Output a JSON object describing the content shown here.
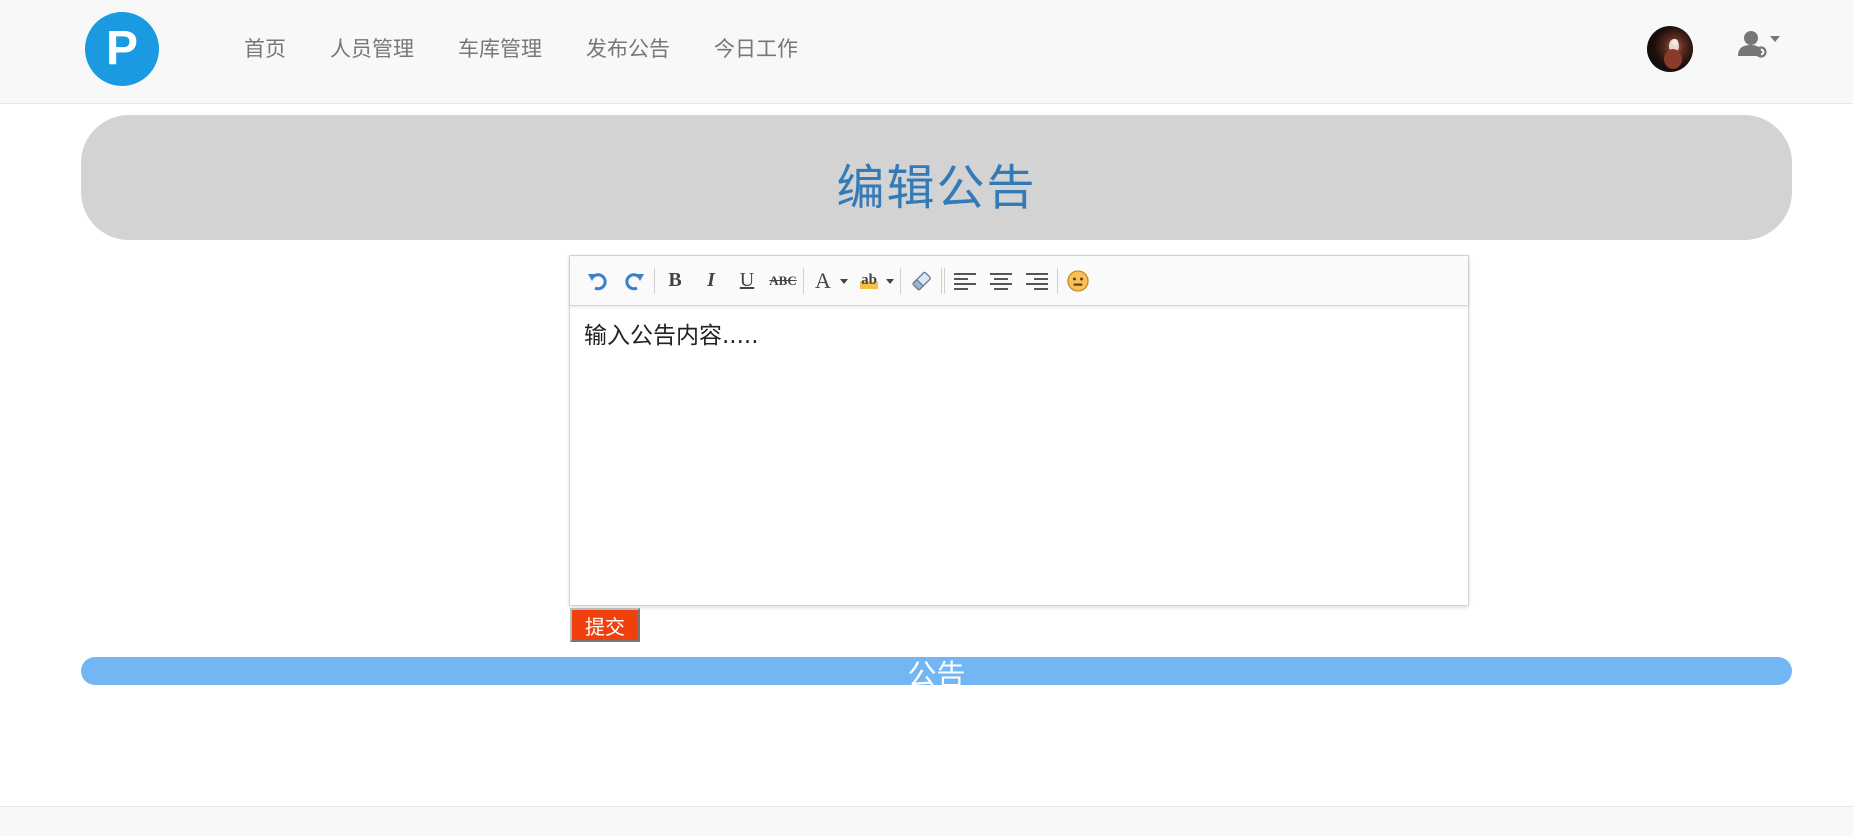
{
  "nav": {
    "logo_letter": "P",
    "links": [
      "首页",
      "人员管理",
      "车库管理",
      "发布公告",
      "今日工作"
    ],
    "avatar_icon": "user-avatar",
    "user_menu_icon": "user-gear-icon"
  },
  "banner": {
    "title": "编辑公告"
  },
  "editor": {
    "toolbar": [
      "undo-icon",
      "redo-icon",
      "bold-icon",
      "italic-icon",
      "underline-icon",
      "strikethrough-icon",
      "font-color-icon",
      "highlight-color-icon",
      "eraser-icon",
      "align-left-icon",
      "align-center-icon",
      "align-right-icon",
      "emoji-icon"
    ],
    "toolbar_labels": {
      "bold": "B",
      "italic": "I",
      "underline": "U",
      "strike": "ABC",
      "font_color": "A",
      "highlight": "ab"
    },
    "content": "输入公告内容....."
  },
  "submit_label": "提交",
  "notice": {
    "title": "公告"
  },
  "colors": {
    "logo_bg": "#1a9ae0",
    "banner_bg": "#d3d3d3",
    "banner_title": "#337ab7",
    "submit_bg": "#f0400e",
    "notice_bg": "#73b6f4"
  }
}
